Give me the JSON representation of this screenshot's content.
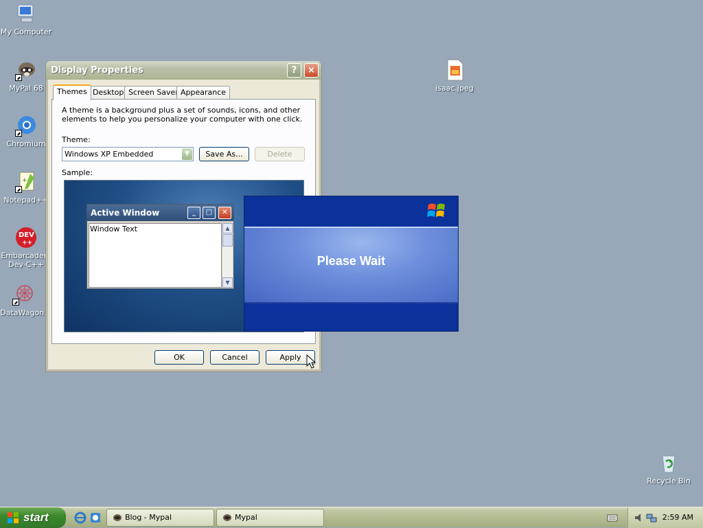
{
  "desktop": {
    "icons": [
      {
        "label": "My Computer",
        "icon": "my-computer-icon"
      },
      {
        "label": "MyPal 68",
        "icon": "mypal-raccoon-icon"
      },
      {
        "label": "Chromium",
        "icon": "chromium-icon"
      },
      {
        "label": "Notepad++",
        "icon": "notepad-plus-plus-icon"
      },
      {
        "label": "Embarcadero Dev-C++",
        "label_line1": "Embarcadero",
        "label_line2": "Dev-C++",
        "icon": "devcpp-icon"
      },
      {
        "label": "DataWagon.",
        "icon": "datawagon-icon"
      },
      {
        "label": "isaac.jpeg",
        "icon": "jpeg-file-icon"
      },
      {
        "label": "Recycle Bin",
        "icon": "recycle-bin-icon"
      }
    ]
  },
  "dialog": {
    "title": "Display Properties",
    "help_button": "?",
    "close_button": "×",
    "tabs": [
      "Themes",
      "Desktop",
      "Screen Saver",
      "Appearance"
    ],
    "active_tab": "Themes",
    "description": "A theme is a background plus a set of sounds, icons, and other elements to help you personalize your computer with one click.",
    "theme_label": "Theme:",
    "theme_value": "Windows XP Embedded",
    "save_as_button": "Save As...",
    "delete_button": "Delete",
    "sample_label": "Sample:",
    "sample": {
      "window_title": "Active Window",
      "window_text": "Window Text"
    },
    "ok_button": "OK",
    "cancel_button": "Cancel",
    "apply_button": "Apply"
  },
  "splash": {
    "text": "Please Wait"
  },
  "taskbar": {
    "start_label": "start",
    "tasks": [
      {
        "label": "Blog - Mypal",
        "icon": "mypal-raccoon-icon"
      },
      {
        "label": "Mypal",
        "icon": "mypal-raccoon-icon"
      }
    ],
    "clock": "2:59 AM"
  },
  "colors": {
    "desktop_bg": "#98a8b8",
    "splash_blue": "#0b329b",
    "start_green": "#3d8a2d"
  }
}
